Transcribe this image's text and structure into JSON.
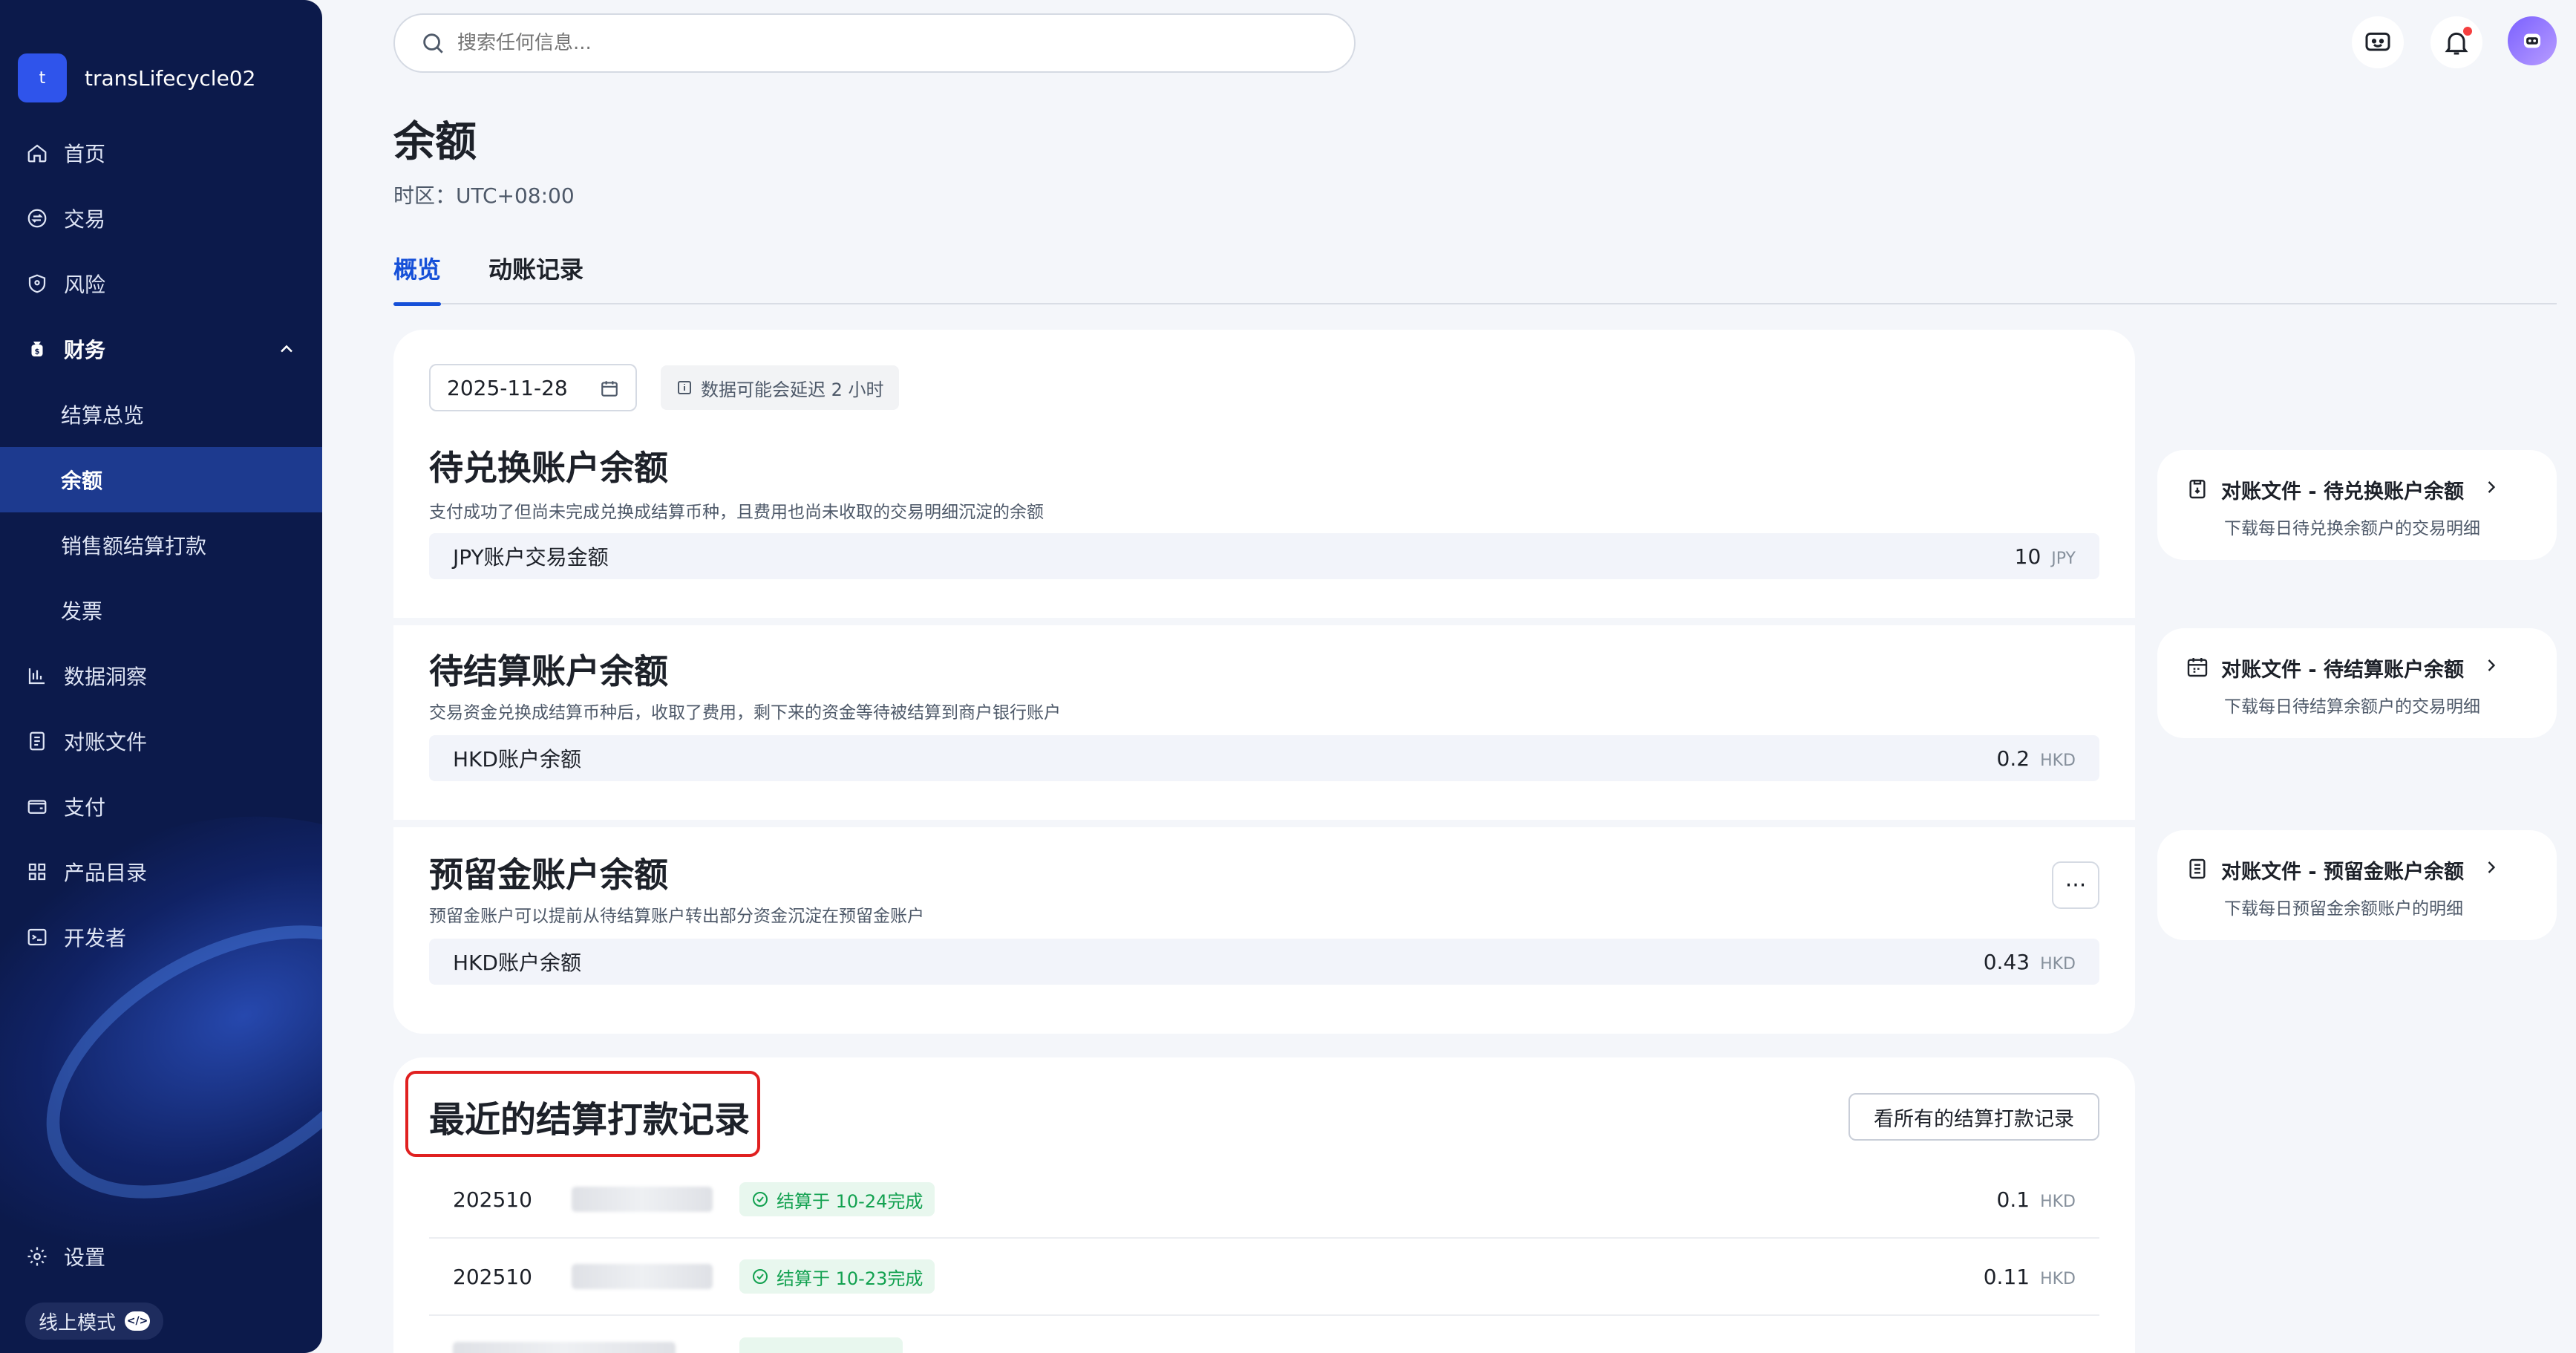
{
  "sidebar": {
    "org_initial": "t",
    "org_name": "transLifecycle02",
    "items": [
      {
        "label": "首页",
        "icon": "home-icon"
      },
      {
        "label": "交易",
        "icon": "exchange-icon"
      },
      {
        "label": "风险",
        "icon": "shield-icon"
      },
      {
        "label": "财务",
        "icon": "finance-icon"
      },
      {
        "label": "结算总览"
      },
      {
        "label": "余额"
      },
      {
        "label": "销售额结算打款"
      },
      {
        "label": "发票"
      },
      {
        "label": "数据洞察",
        "icon": "bar-chart-icon"
      },
      {
        "label": "对账文件",
        "icon": "file-icon"
      },
      {
        "label": "支付",
        "icon": "wallet-icon"
      },
      {
        "label": "产品目录",
        "icon": "grid-icon"
      },
      {
        "label": "开发者",
        "icon": "terminal-icon"
      }
    ],
    "settings_label": "设置",
    "mode_label": "线上模式",
    "mode_code_glyph": "</>"
  },
  "search": {
    "placeholder": "搜索任何信息..."
  },
  "page": {
    "title": "余额",
    "timezone": "时区：UTC+08:00"
  },
  "tabs": [
    {
      "label": "概览",
      "active": true
    },
    {
      "label": "动账记录",
      "active": false
    }
  ],
  "filters": {
    "date": "2025-11-28",
    "delay_note": "数据可能会延迟 2 小时"
  },
  "sections": [
    {
      "title": "待兑换账户余额",
      "desc": "支付成功了但尚未完成兑换成结算币种，且费用也尚未收取的交易明细沉淀的余额",
      "row_label": "JPY账户交易金额",
      "row_value": "10",
      "row_currency": "JPY"
    },
    {
      "title": "待结算账户余额",
      "desc": "交易资金兑换成结算币种后，收取了费用，剩下来的资金等待被结算到商户银行账户",
      "row_label": "HKD账户余额",
      "row_value": "0.2",
      "row_currency": "HKD"
    },
    {
      "title": "预留金账户余额",
      "desc": "预留金账户可以提前从待结算账户转出部分资金沉淀在预留金账户",
      "row_label": "HKD账户余额",
      "row_value": "0.43",
      "row_currency": "HKD",
      "more_label": "···"
    }
  ],
  "side_links": [
    {
      "title": "对账文件 - 待兑换账户余额",
      "desc": "下载每日待兑换余额户的交易明细",
      "icon": "clipboard-icon"
    },
    {
      "title": "对账文件 - 待结算账户余额",
      "desc": "下载每日待结算余额户的交易明细",
      "icon": "calendar-icon"
    },
    {
      "title": "对账文件 - 预留金账户余额",
      "desc": "下载每日预留金余额账户的明细",
      "icon": "document-icon"
    }
  ],
  "records": {
    "title": "最近的结算打款记录",
    "view_all": "看所有的结算打款记录",
    "rows": [
      {
        "id": "202510",
        "status": "结算于 10-24完成",
        "amount": "0.1",
        "currency": "HKD"
      },
      {
        "id": "202510",
        "status": "结算于 10-23完成",
        "amount": "0.11",
        "currency": "HKD"
      }
    ]
  },
  "colors": {
    "sidebar_bg": "#0c1a4b",
    "accent": "#1650d8",
    "success": "#12a150",
    "highlight_box": "#e02020"
  }
}
